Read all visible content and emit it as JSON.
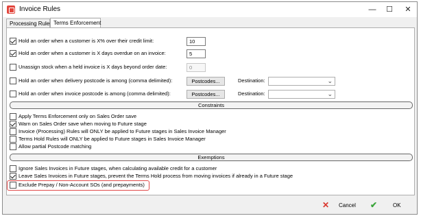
{
  "window": {
    "title": "Invoice Rules",
    "controls": {
      "minimize": "—",
      "maximize": "☐",
      "close": "✕"
    }
  },
  "tabs": [
    {
      "label": "Processing Rules",
      "active": false
    },
    {
      "label": "Terms Enforcement",
      "active": true
    }
  ],
  "terms": {
    "credit_limit": {
      "label": "Hold an order when a customer is X% over their credit limit:",
      "checked": true,
      "value": "10"
    },
    "days_overdue": {
      "label": "Hold an order when a customer is X days overdue on an invoice:",
      "checked": true,
      "value": "5"
    },
    "unassign_stock": {
      "label": "Unassign stock when a held invoice is X days beyond order date:",
      "checked": false,
      "value": "0"
    },
    "delivery_postcode": {
      "label": "Hold an order when delivery postcode is among (comma delimited):",
      "checked": false,
      "button": "Postcodes...",
      "dest_label": "Destination:",
      "dest_value": ""
    },
    "invoice_postcode": {
      "label": "Hold an order when invoice postcode is among (comma delimited):",
      "checked": false,
      "button": "Postcodes...",
      "dest_label": "Destination:",
      "dest_value": ""
    }
  },
  "constraints": {
    "header": "Constraints",
    "items": [
      {
        "label": "Apply Terms Enforcement only on Sales Order save",
        "checked": false
      },
      {
        "label": "Warn on Sales Order save when moving to Future stage",
        "checked": true
      },
      {
        "label": "Invoice (Processing) Rules will ONLY be applied to Future stages in Sales Invoice Manager",
        "checked": false
      },
      {
        "label": "Terms Hold Rules will ONLY be applied to Future stages in Sales Invoice Manager",
        "checked": false
      },
      {
        "label": "Allow partial Postcode matching",
        "checked": false
      }
    ]
  },
  "exemptions": {
    "header": "Exemptions",
    "items": [
      {
        "label": "Ignore Sales Invoices in Future stages, when calculating available credit for a customer",
        "checked": false
      },
      {
        "label": "Leave Sales Invoices in Future stages, prevent the Terms Hold process from moving invoices if already in a Future stage",
        "checked": true
      },
      {
        "label": "Exclude Prepay / Non-Account SOs (and prepayments)",
        "checked": false
      }
    ]
  },
  "footer": {
    "cancel_icon": "✕",
    "cancel_label": "Cancel",
    "ok_icon": "✔",
    "ok_label": "OK"
  },
  "colors": {
    "cancel_icon": "#d9342b",
    "ok_icon": "#3aa53a",
    "highlight": "#e04a4a"
  }
}
